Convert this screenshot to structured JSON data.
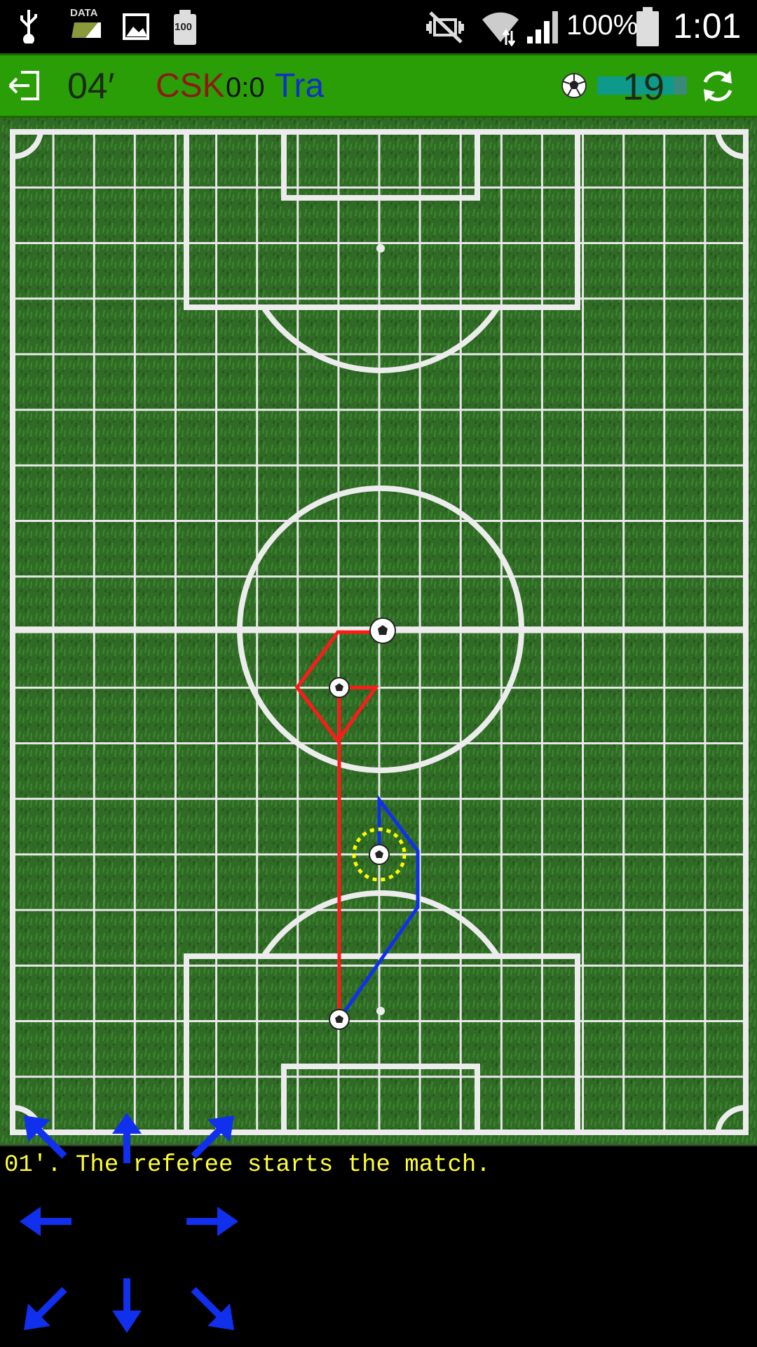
{
  "status_bar": {
    "icons": [
      "usb-icon",
      "data-icon",
      "image-icon",
      "battery-saver-icon",
      "mute-icon",
      "wifi-icon",
      "signal-icon",
      "battery-icon"
    ],
    "data_label": "DATA",
    "battery_label": "100",
    "battery_percent": "100%",
    "time": "1:01"
  },
  "top_bar": {
    "exit_icon": "exit-icon",
    "match_time": "04′",
    "team_home": "CSK",
    "score": "0:0",
    "team_away": "Tra",
    "ball_icon": "ball-icon",
    "stamina_level": 0.85,
    "counter": "19",
    "refresh_icon": "refresh-icon",
    "colors": {
      "bar": "#2a9e06",
      "home": "#8c1b14",
      "away": "#1030cc"
    }
  },
  "pitch": {
    "colors": {
      "grass": "#2f6b25",
      "lines": "#ececec",
      "home_path": "#ff1a1a",
      "away_path": "#1030ee",
      "selection": "#ffff00"
    }
  },
  "log": {
    "message": "01'. The referee starts the match."
  },
  "controls": {
    "arrows": [
      "arrow-up-left-icon",
      "arrow-up-icon",
      "arrow-up-right-icon",
      "arrow-left-icon",
      "arrow-right-icon",
      "arrow-down-left-icon",
      "arrow-down-icon",
      "arrow-down-right-icon"
    ],
    "color": "#1030ee"
  }
}
